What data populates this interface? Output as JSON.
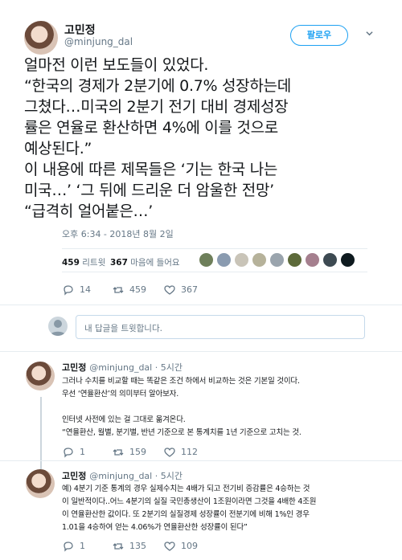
{
  "main_tweet": {
    "author_name": "고민정",
    "author_handle": "@minjung_dal",
    "follow_label": "팔로우",
    "text_lines": [
      "얼마전 이런 보도들이 있었다.",
      "“한국의 경제가 2분기에 0.7% 성장하는데",
      "그쳤다…미국의 2분기 전기 대비 경제성장",
      "률은 연율로 환산하면 4%에 이를 것으로",
      "예상된다.”",
      "이 내용에 따른 제목들은 ‘기는 한국 나는",
      "미국…’ ‘그 뒤에 드리운 더 암울한 전망’",
      "“급격히 얼어붙은…’"
    ],
    "timestamp": "오후 6:34 - 2018년 8월 2일",
    "retweet_count": "459",
    "retweet_label": "리트윗",
    "like_count": "367",
    "like_label": "마음에 들어요",
    "liker_colors": [
      "#6e7f5a",
      "#8a9bb0",
      "#c9c4b8",
      "#b6b29a",
      "#9aa4ad",
      "#5d6a3a",
      "#a57f8e",
      "#3d4a52",
      "#0e1a1f"
    ],
    "actions": {
      "reply": "14",
      "retweet": "459",
      "like": "367"
    }
  },
  "reply_box": {
    "placeholder": "내 답글을 트윗합니다."
  },
  "thread": [
    {
      "author_name": "고민정",
      "meta": "@minjung_dal · 5시간",
      "lines": [
        "그러나 수치를 비교할 때는 똑같은 조건 하에서 비교하는 것은 기본일 것이다.",
        "우선 ‘연율환산’의 의미부터 알아보자.",
        "인터넷 사전에 있는 걸 그대로 옮겨온다.",
        "“연율환산, 월별, 분기별, 반년 기준으로 본 통계치를 1년 기준으로 고치는 것."
      ],
      "actions": {
        "reply": "1",
        "retweet": "159",
        "like": "112"
      }
    },
    {
      "author_name": "고민정",
      "meta": "@minjung_dal · 5시간",
      "lines": [
        "예) 4분기 기준 통계의 경우 실제수치는 4배가 되고 전기비 증감률은 4승하는 것",
        "이 일반적이다..어느 4분기의 실질 국민총생산이 1조원이라면 그것을 4배한 4조원",
        "이 연율환산한 값이다. 또 2분기의 실질경제 성장률이 전분기에 비해 1%인 경우",
        "1.01을 4승하여 얻는 4.06%가 연율환산한 성장률이 된다”"
      ],
      "actions": {
        "reply": "1",
        "retweet": "135",
        "like": "109"
      }
    }
  ],
  "colors": {
    "accent": "#1da1f2",
    "muted": "#657786",
    "text": "#14171a"
  }
}
